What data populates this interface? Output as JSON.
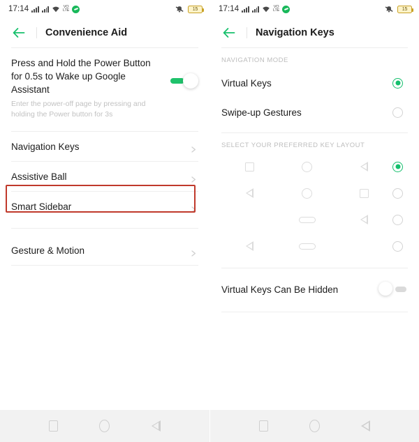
{
  "colors": {
    "accent_green": "#15bf6d",
    "highlight_red": "#c0392b",
    "text_primary": "#1c1c1c",
    "text_muted": "#bdbdbd",
    "navbar_bg": "#f2f2f2"
  },
  "status_bar": {
    "time": "17:14",
    "volte_label": "VoLTE",
    "battery_level": "15",
    "icons": [
      "signal-bars-icon",
      "signal-bars-icon",
      "wifi-icon",
      "volte-icon",
      "green-record-icon",
      "bell-off-icon",
      "battery-icon"
    ]
  },
  "left_screen": {
    "appbar": {
      "back_label": "back-arrow",
      "title": "Convenience Aid"
    },
    "power_setting": {
      "title": "Press and Hold the Power Button for 0.5s to Wake up Google Assistant",
      "subtitle": "Enter the power-off page by pressing and holding the Power button for 3s",
      "toggle_state": "on"
    },
    "items": [
      {
        "label": "Navigation Keys",
        "highlighted": true
      },
      {
        "label": "Assistive Ball",
        "highlighted": false
      },
      {
        "label": "Smart Sidebar",
        "highlighted": false
      },
      {
        "label": "Gesture & Motion",
        "highlighted": false
      }
    ]
  },
  "right_screen": {
    "appbar": {
      "back_label": "back-arrow",
      "title": "Navigation Keys"
    },
    "navigation_mode": {
      "section_label": "NAVIGATION MODE",
      "options": [
        {
          "label": "Virtual Keys",
          "selected": true
        },
        {
          "label": "Swipe-up Gestures",
          "selected": false
        }
      ]
    },
    "key_layout": {
      "section_label": "SELECT YOUR PREFERRED KEY LAYOUT",
      "rows": [
        {
          "keys": [
            "square",
            "circle",
            "triangle"
          ],
          "selected": true
        },
        {
          "keys": [
            "triangle",
            "circle",
            "square"
          ],
          "selected": false
        },
        {
          "keys": [
            "empty",
            "pill",
            "triangle"
          ],
          "selected": false
        },
        {
          "keys": [
            "triangle",
            "pill",
            "empty"
          ],
          "selected": false
        }
      ]
    },
    "hide_keys": {
      "label": "Virtual Keys Can Be Hidden",
      "toggle_state": "off"
    }
  },
  "navbar": {
    "buttons": [
      "recents-square-icon",
      "home-circle-icon",
      "back-triangle-icon"
    ]
  }
}
